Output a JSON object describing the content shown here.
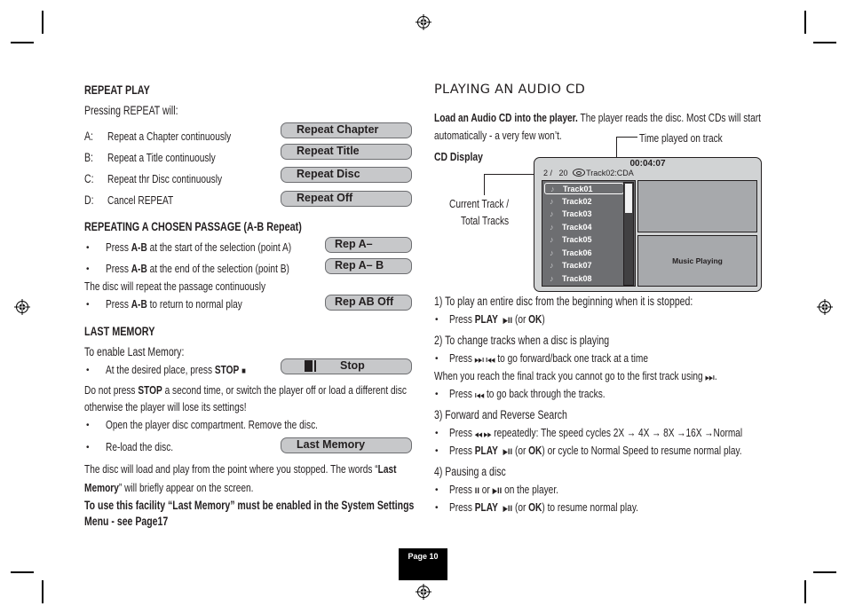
{
  "left": {
    "repeat_play": {
      "heading": "REPEAT PLAY",
      "intro": "Pressing REPEAT will:",
      "items": [
        {
          "key": "A:",
          "text": "Repeat a Chapter continuously",
          "button": "Repeat Chapter"
        },
        {
          "key": "B:",
          "text": "Repeat a Title continuously",
          "button": "Repeat Title"
        },
        {
          "key": "C:",
          "text": "Repeat thr Disc continuously",
          "button": "Repeat Disc"
        },
        {
          "key": "D:",
          "text": "Cancel REPEAT",
          "button": "Repeat Off"
        }
      ]
    },
    "ab_repeat": {
      "heading": "REPEATING A CHOSEN PASSAGE (A-B Repeat)",
      "bullet1": {
        "pre": "Press ",
        "key": "A-B",
        "post": " at the start of the selection (point A)",
        "button": "Rep A–"
      },
      "bullet2": {
        "pre": "Press ",
        "key": "A-B",
        "post": " at the end of the selection (point B)",
        "button": "Rep A– B"
      },
      "note": "The disc will repeat the passage continuously",
      "bullet3": {
        "pre": "Press ",
        "key": "A-B",
        "post": " to return to normal play",
        "button": "Rep AB Off"
      }
    },
    "last_memory": {
      "heading": "LAST MEMORY",
      "intro": "To enable Last Memory:",
      "bullet1": {
        "pre": "At the desired place, press ",
        "key": "STOP",
        "symbol": "■",
        "button": "Stop"
      },
      "warn_pre": "Do not press ",
      "warn_key": "STOP",
      "warn_post": " a second time, or switch the player off or load a different disc",
      "warn_line2": "otherwise the player will lose its settings!",
      "bullet2": "Open the player disc compartment. Remove the disc.",
      "bullet3": "Re-load the disc.",
      "button_last_memory": "Last Memory",
      "result_pre": "The disc will load and play from the point where you stopped. The words “",
      "result_key1": "Last",
      "result_key2": "Memory",
      "result_post": "” will briefly appear on the screen.",
      "facility_line1": "To use this facility  “Last Memory” must be enabled in the System Settings",
      "facility_line2": "Menu - see Page17"
    }
  },
  "right": {
    "title": "PLAYING AN AUDIO CD",
    "intro_bold": "Load an Audio CD into the player.",
    "intro_rest": " The player reads the disc. Most CDs will start",
    "intro_line2": "automatically - a very few won’t.",
    "cd_display_label": "CD Display",
    "callout_time": "Time played on track",
    "callout_track_line1": "Current Track /",
    "callout_track_line2": "Total Tracks",
    "cd_display": {
      "time": "00:04:07",
      "current_track": "2 /",
      "total_tracks": "20",
      "file": "Track02:CDA",
      "tracks": [
        "Track01",
        "Track02",
        "Track03",
        "Track04",
        "Track05",
        "Track06",
        "Track07",
        "Track08"
      ],
      "selected_index": 0,
      "status": "Music Playing"
    },
    "sections": [
      {
        "heading": "1)  To play an entire disc from the beginning when it is stopped:"
      },
      {
        "heading": "2)  To  change tracks when a disc is playing"
      },
      {
        "heading": "3)  Forward and Reverse Search"
      },
      {
        "heading": "4)  Pausing a disc"
      }
    ],
    "s1_b1": {
      "pre": "Press ",
      "key": "PLAY",
      "sym": "▶II",
      "mid": " (or ",
      "key2": "OK",
      "post": ")"
    },
    "s2_b1": {
      "pre": "Press ",
      "sym": "▶▶I  I◀◀",
      "post": "  to go forward/back one track at a time"
    },
    "s2_note": {
      "pre": "When you reach the final track you cannot go to the first track using ",
      "sym": "▶▶I",
      "post": "."
    },
    "s2_b2": {
      "pre": "Press ",
      "sym": "I◀◀",
      "post": " to go back through the tracks."
    },
    "s3_b1": {
      "pre": "Press  ",
      "sym": "◀◀  ▶▶",
      "post": " repeatedly: The speed cycles   2X → 4X → 8X →16X →Normal"
    },
    "s3_b2": {
      "pre": "Press ",
      "key": "PLAY",
      "sym": "▶II",
      "mid": " (or ",
      "key2": "OK",
      "post": ") or cycle to Normal Speed to resume normal play."
    },
    "s4_b1": {
      "pre": "Press ",
      "sym1": "II",
      "mid": " or ",
      "sym2": "▶II",
      "post": " on the player."
    },
    "s4_b2": {
      "pre": "Press ",
      "key": "PLAY",
      "sym": "▶II",
      "mid": " (or ",
      "key2": "OK",
      "post": ") to resume normal play."
    }
  },
  "footer": {
    "page_label": "Page 10"
  }
}
